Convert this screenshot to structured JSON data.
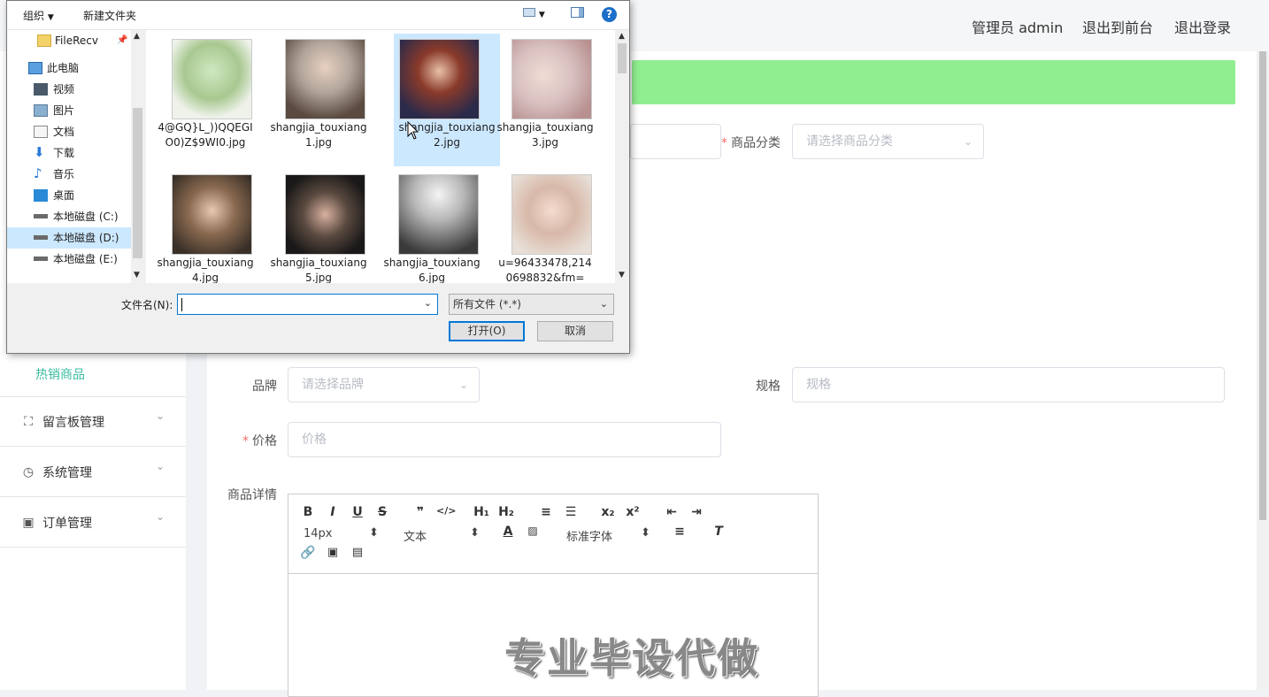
{
  "topbar": {
    "admin_label": "管理员 admin",
    "frontend_link": "退出到前台",
    "logout_link": "退出登录"
  },
  "sidebar": {
    "hot_goods": "热销商品",
    "menus": [
      {
        "label": "留言板管理",
        "icon": "fullscreen-icon"
      },
      {
        "label": "系统管理",
        "icon": "clock-icon"
      },
      {
        "label": "订单管理",
        "icon": "clipboard-icon"
      }
    ]
  },
  "form": {
    "category_label": "商品分类",
    "category_placeholder": "请选择商品分类",
    "brand_label": "品牌",
    "brand_placeholder": "请选择品牌",
    "spec_label": "规格",
    "spec_placeholder": "规格",
    "price_label": "价格",
    "price_placeholder": "价格",
    "detail_label": "商品详情"
  },
  "editor": {
    "font_size": "14px",
    "paragraph": "文本",
    "font_family": "标准字体",
    "watermark": "专业毕设代做"
  },
  "dialog": {
    "toolbar": {
      "organize": "组织",
      "new_folder": "新建文件夹"
    },
    "nav": [
      {
        "label": "FileRecv",
        "icon": "folder-icon",
        "indent": true
      },
      {
        "label": "此电脑",
        "icon": "computer-icon"
      },
      {
        "label": "视频",
        "icon": "video-icon"
      },
      {
        "label": "图片",
        "icon": "picture-icon"
      },
      {
        "label": "文档",
        "icon": "document-icon"
      },
      {
        "label": "下载",
        "icon": "download-icon"
      },
      {
        "label": "音乐",
        "icon": "music-icon"
      },
      {
        "label": "桌面",
        "icon": "desktop-icon"
      },
      {
        "label": "本地磁盘 (C:)",
        "icon": "drive-icon"
      },
      {
        "label": "本地磁盘 (D:)",
        "icon": "drive-icon",
        "selected": true
      },
      {
        "label": "本地磁盘 (E:)",
        "icon": "drive-icon"
      }
    ],
    "files": [
      {
        "name": "4@GQ}L_))QQEGIO0)Z$9WI0.jpg",
        "color": "#a8c890"
      },
      {
        "name": "shangjia_touxiang1.jpg",
        "color": "#b0a49a"
      },
      {
        "name": "shangjia_touxiang2.jpg",
        "color": "#8a3a2a",
        "selected": true
      },
      {
        "name": "shangjia_touxiang3.jpg",
        "color": "#d8c0c0"
      },
      {
        "name": "shangjia_touxiang4.jpg",
        "color": "#5a4a3a"
      },
      {
        "name": "shangjia_touxiang5.jpg",
        "color": "#3a3030"
      },
      {
        "name": "shangjia_touxiang6.jpg",
        "color": "#6a6a6a"
      },
      {
        "name": "u=96433478,2140698832&fm=",
        "color": "#d8b8a8"
      }
    ],
    "filename_label": "文件名(N):",
    "filename_value": "",
    "filetype": "所有文件 (*.*)",
    "open_button": "打开(O)",
    "cancel_button": "取消"
  }
}
